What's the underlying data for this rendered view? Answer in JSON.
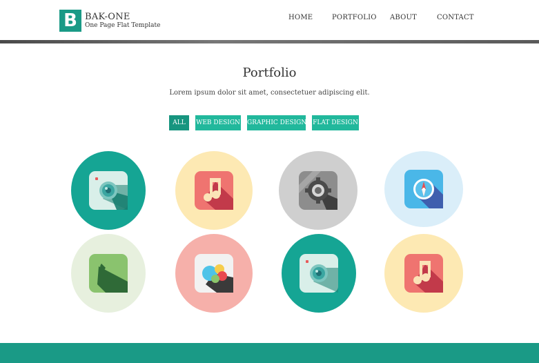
{
  "brand": {
    "logo_letter": "B",
    "title": "BAK-ONE",
    "subtitle": "One Page Flat Template"
  },
  "nav": {
    "items": [
      {
        "label": "HOME"
      },
      {
        "label": "PORTFOLIO"
      },
      {
        "label": "ABOUT"
      },
      {
        "label": "CONTACT"
      }
    ]
  },
  "portfolio": {
    "title": "Portfolio",
    "subtitle": "Lorem ipsum dolor sit amet, consectetuer adipiscing elit.",
    "filters": [
      {
        "label": "ALL",
        "active": true
      },
      {
        "label": "WEB DESIGN",
        "active": false
      },
      {
        "label": "GRAPHIC DESIGN",
        "active": false
      },
      {
        "label": "FLAT DESIGN",
        "active": false
      }
    ],
    "items": [
      {
        "icon": "camera-icon",
        "bg": "#15a594"
      },
      {
        "icon": "music-icon",
        "bg": "#fde9b3"
      },
      {
        "icon": "settings-icon",
        "bg": "#cfcfcf"
      },
      {
        "icon": "compass-icon",
        "bg": "#daeef9"
      },
      {
        "icon": "phone-icon",
        "bg": "#e7f0de"
      },
      {
        "icon": "chat-bubbles-icon",
        "bg": "#f6b0aa"
      },
      {
        "icon": "camera-icon",
        "bg": "#15a594"
      },
      {
        "icon": "music-icon",
        "bg": "#fde9b3"
      }
    ]
  },
  "colors": {
    "accent": "#21b89c",
    "accent_dark": "#1a9a86"
  }
}
